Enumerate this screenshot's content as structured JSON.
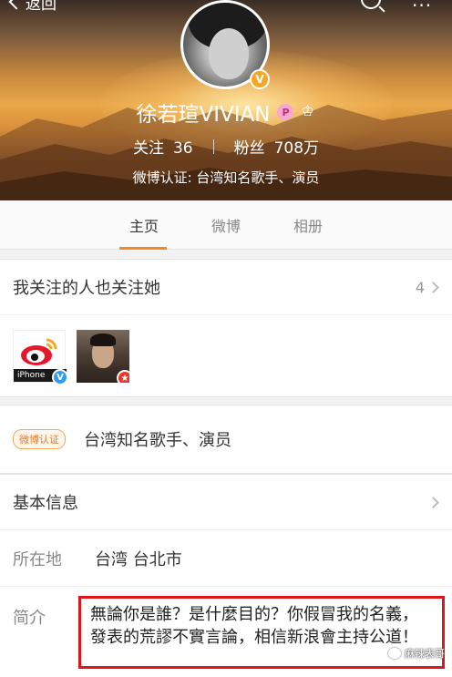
{
  "header": {
    "back_label": "返回",
    "name": "徐若瑄VIVIAN",
    "level_glyph": "P",
    "verify_badge": "V",
    "following_label": "关注",
    "following_count": "36",
    "followers_label": "粉丝",
    "followers_count": "708万",
    "verify_text": "微博认证: 台湾知名歌手、演员"
  },
  "tabs": [
    {
      "label": "主页",
      "active": true
    },
    {
      "label": "微博",
      "active": false
    },
    {
      "label": "相册",
      "active": false
    }
  ],
  "mutual": {
    "title": "我关注的人也关注她",
    "count": "4",
    "avatars": [
      {
        "tag": "iPhone",
        "badge": "V"
      },
      {
        "badge": "★"
      }
    ]
  },
  "verify": {
    "tag": "微博认证",
    "text": "台湾知名歌手、演员"
  },
  "info": {
    "title": "基本信息",
    "location_label": "所在地",
    "location_value": "台湾 台北市",
    "intro_label": "简介",
    "intro_text": "無論你是誰？是什麼目的？你假冒我的名義，發表的荒謬不實言論，相信新浪會主持公道！"
  },
  "watermark": "麻辣表哥",
  "colors": {
    "accent": "#f08a24",
    "highlight_border": "#e0151b",
    "verify_orange": "#f5a623"
  }
}
